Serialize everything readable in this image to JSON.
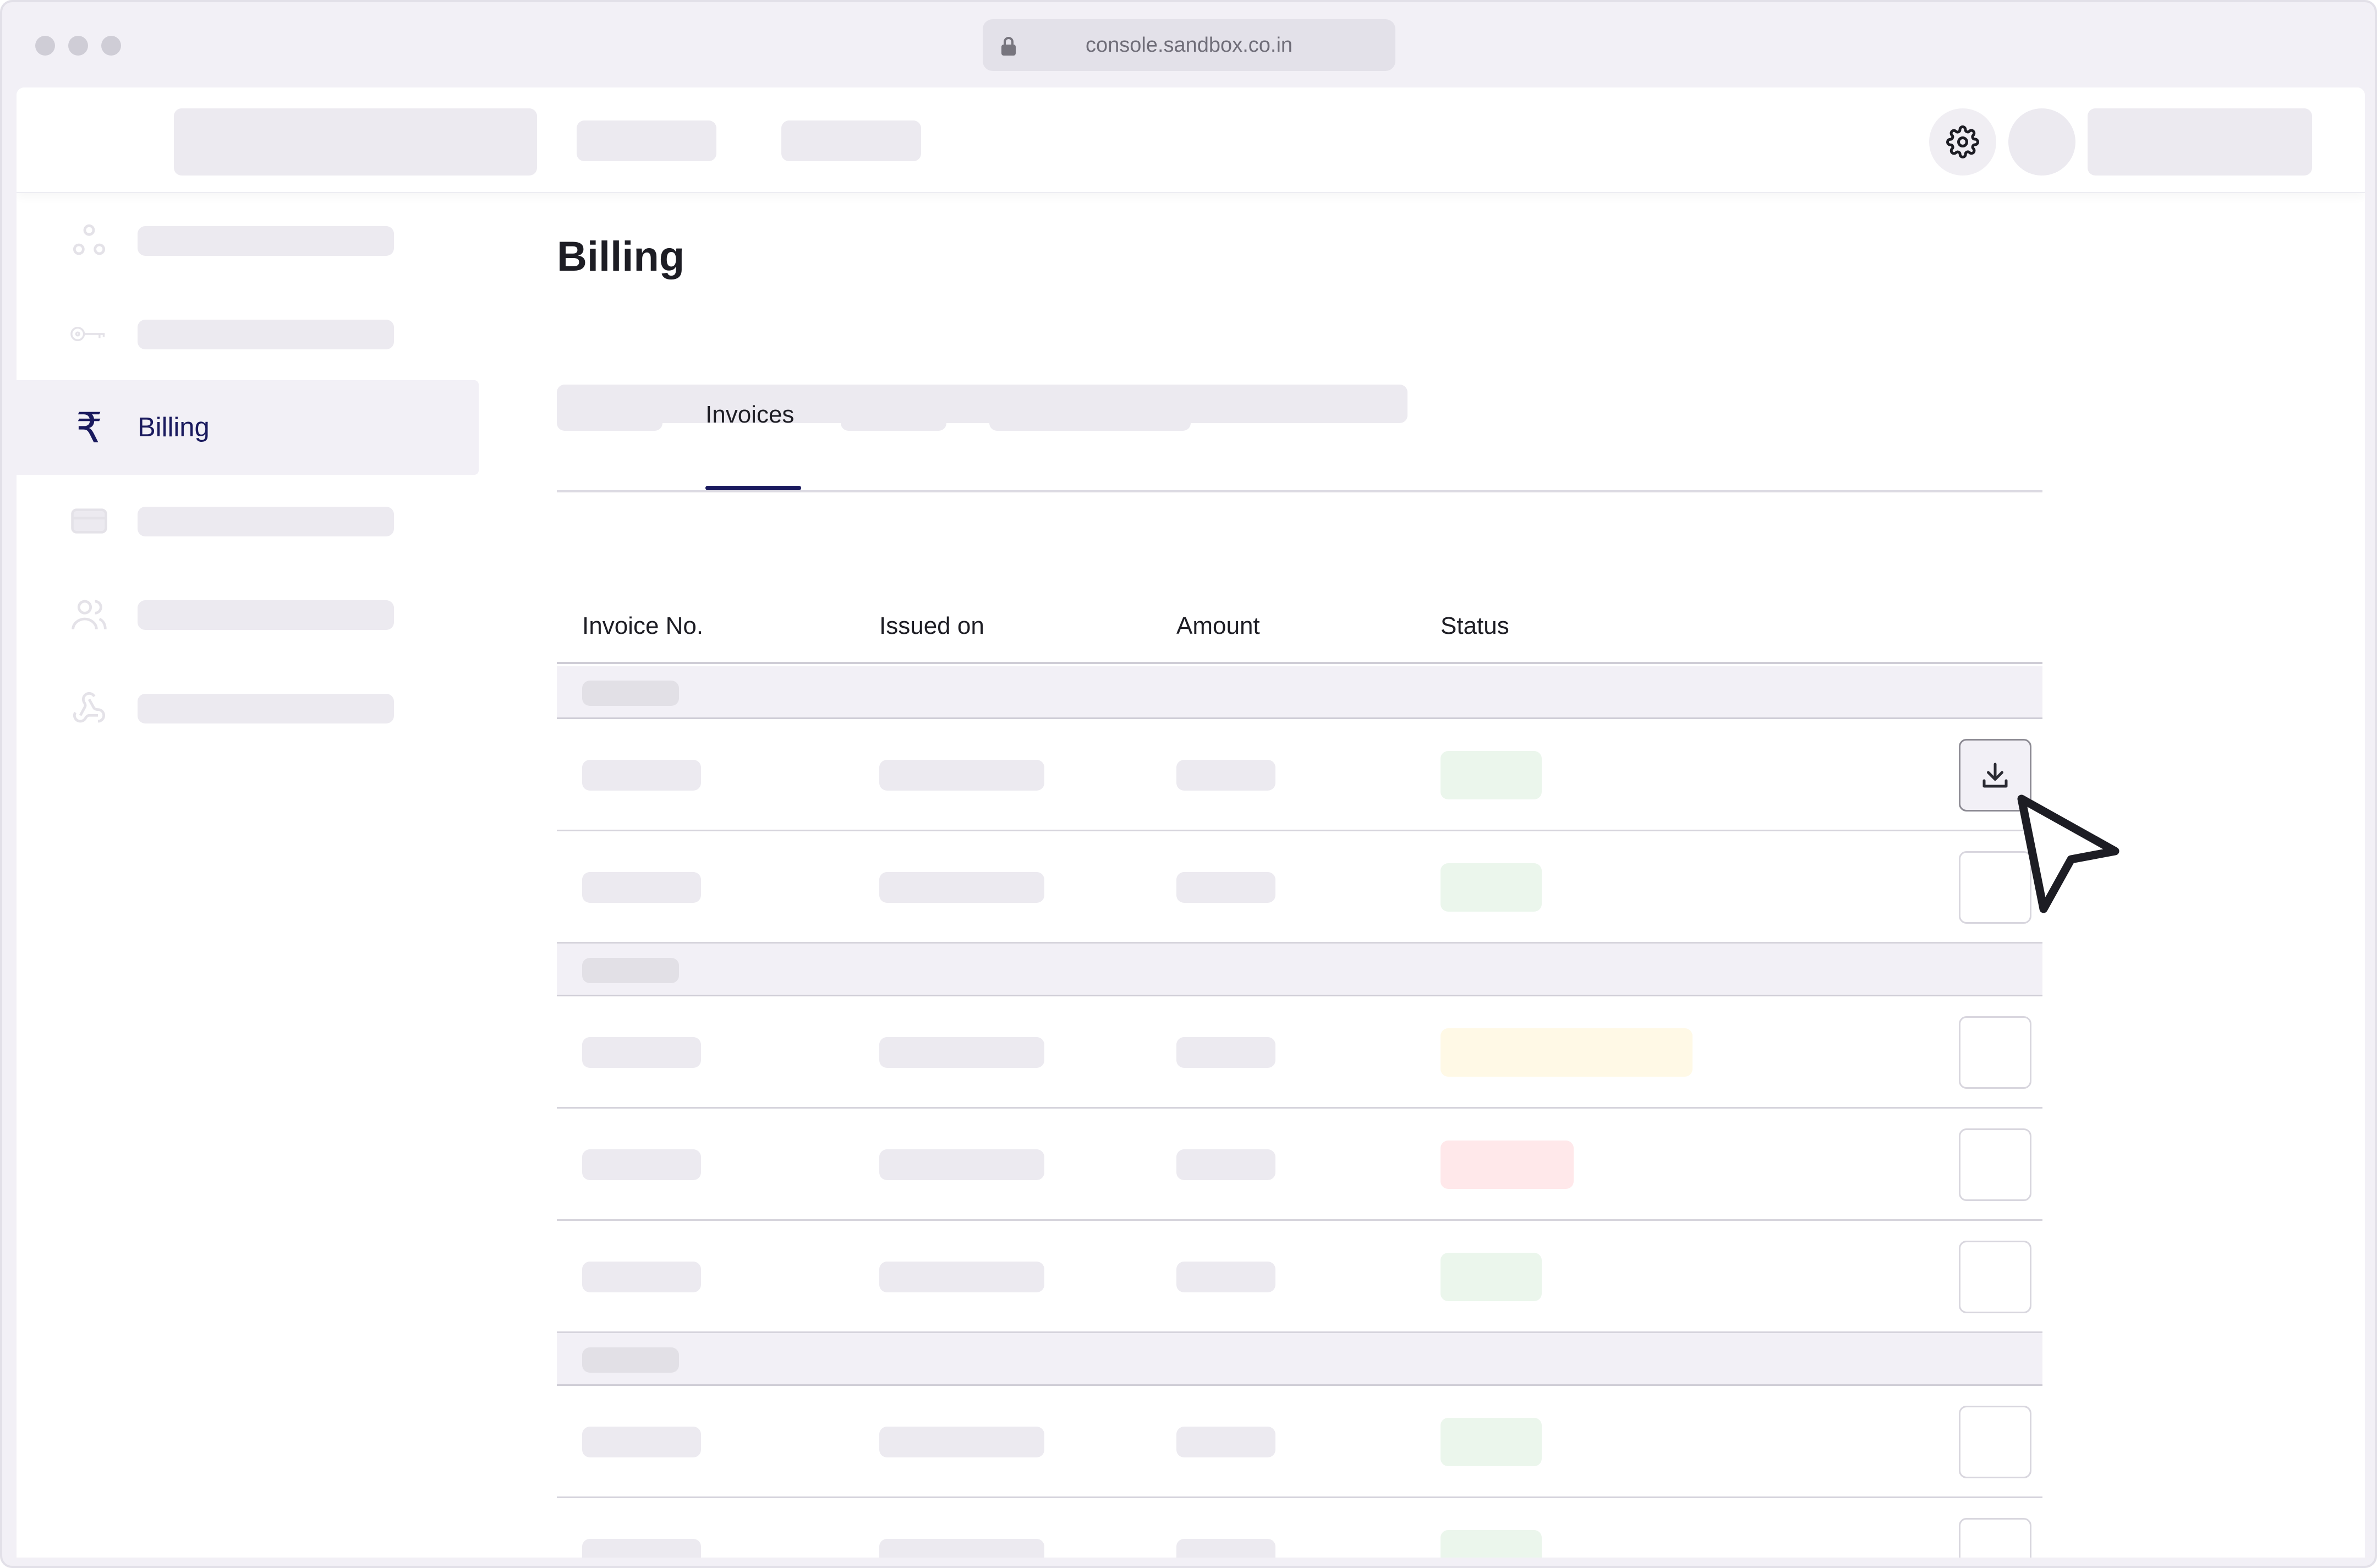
{
  "browser": {
    "url": "console.sandbox.co.in",
    "dots": [
      "#cfcdd6",
      "#cfcdd6",
      "#cfcdd6"
    ]
  },
  "header": {
    "icons": [
      "gear-icon"
    ]
  },
  "sidebar": {
    "items": [
      {
        "icon": "nodes-icon",
        "label": "",
        "active": false
      },
      {
        "icon": "key-icon",
        "label": "",
        "active": false
      },
      {
        "icon": "rupee-icon",
        "label": "Billing",
        "active": true
      },
      {
        "icon": "card-icon",
        "label": "",
        "active": false
      },
      {
        "icon": "users-icon",
        "label": "",
        "active": false
      },
      {
        "icon": "webhook-icon",
        "label": "",
        "active": false
      }
    ],
    "rupee_glyph": "₹"
  },
  "main": {
    "title": "Billing",
    "tabs": [
      {
        "label": "",
        "active": false
      },
      {
        "label": "Invoices",
        "active": true
      },
      {
        "label": "",
        "active": false
      },
      {
        "label": "",
        "active": false
      }
    ],
    "table": {
      "columns": [
        "Invoice No.",
        "Issued on",
        "Amount",
        "Status"
      ],
      "rows": [
        {
          "type": "group"
        },
        {
          "type": "invoice",
          "status_color": "green",
          "hovered": true
        },
        {
          "type": "invoice",
          "status_color": "green",
          "hovered": false
        },
        {
          "type": "group"
        },
        {
          "type": "invoice",
          "status_color": "yellow",
          "hovered": false
        },
        {
          "type": "invoice",
          "status_color": "red",
          "hovered": false
        },
        {
          "type": "invoice",
          "status_color": "green",
          "hovered": false
        },
        {
          "type": "group"
        },
        {
          "type": "invoice",
          "status_color": "green",
          "hovered": false
        },
        {
          "type": "invoice",
          "status_color": "green",
          "hovered": false
        }
      ]
    }
  },
  "colors": {
    "accent": "#1a1a5e",
    "placeholder": "#eceaf0",
    "status_green": "#ebf6ec",
    "status_yellow": "#fff9e6",
    "status_red": "#ffe8ea"
  }
}
